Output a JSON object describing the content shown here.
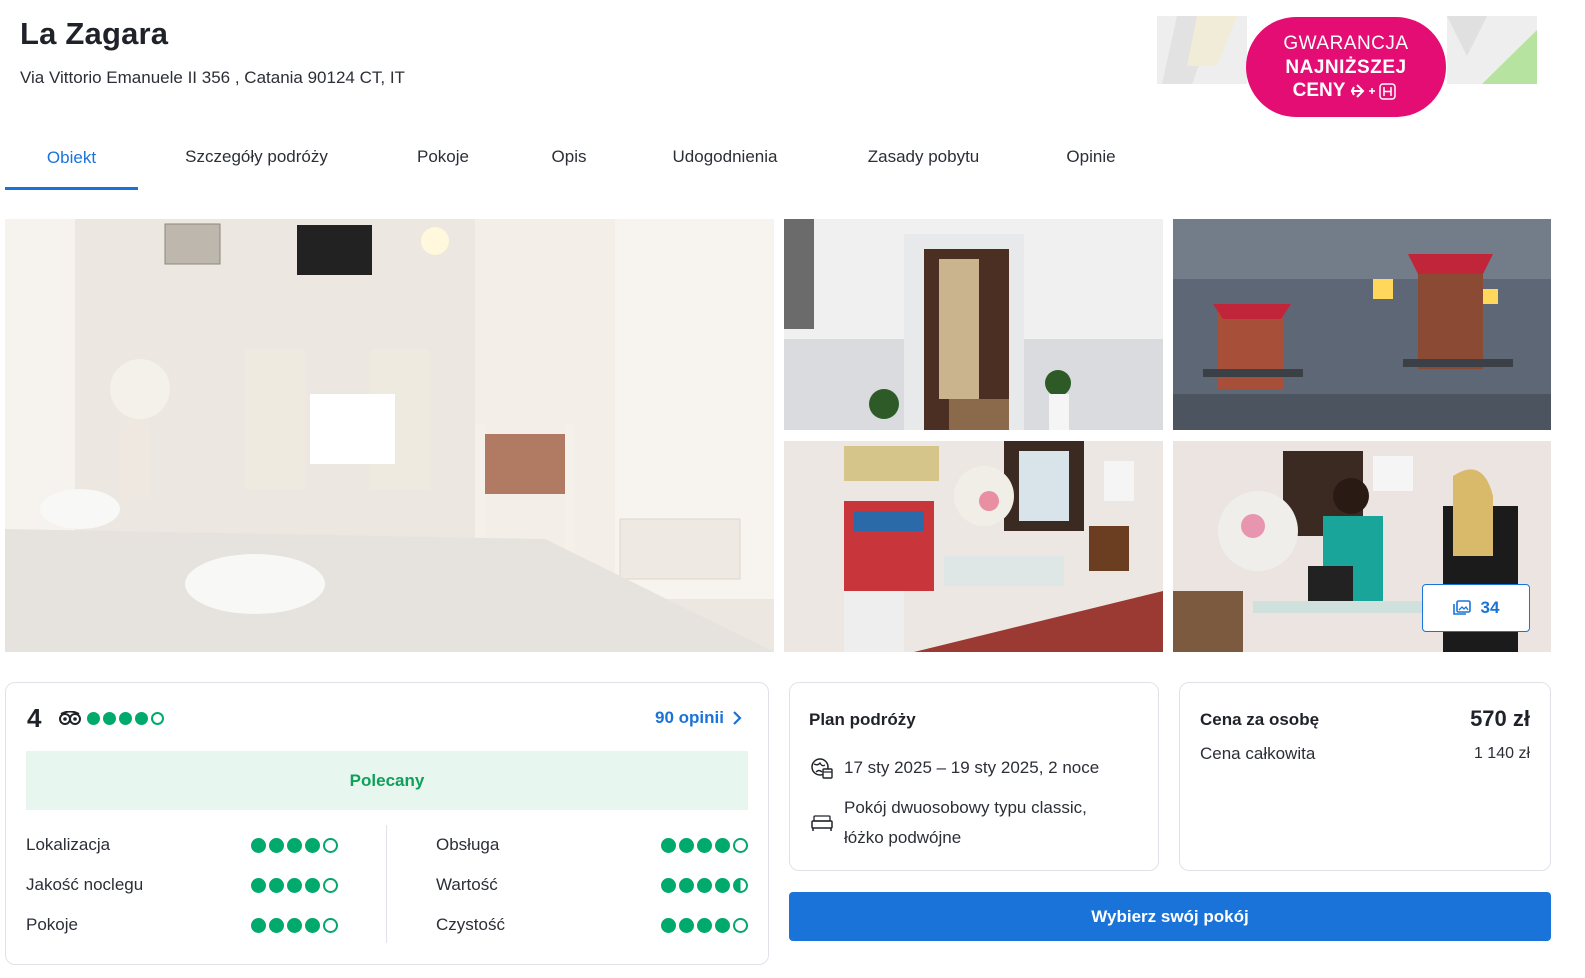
{
  "hotel": {
    "name": "La Zagara",
    "address": "Via Vittorio Emanuele II 356 , Catania 90124 CT, IT"
  },
  "badge": {
    "line1": "GWARANCJA",
    "line2": "NAJNIŻSZEJ",
    "line3": "CENY",
    "icon": "plane-plus-hotel-icon",
    "color": "#e40d74"
  },
  "tabs": [
    {
      "label": "Obiekt",
      "active": true
    },
    {
      "label": "Szczegóły podróży"
    },
    {
      "label": "Pokoje"
    },
    {
      "label": "Opis"
    },
    {
      "label": "Udogodnienia"
    },
    {
      "label": "Zasady pobytu"
    },
    {
      "label": "Opinie"
    }
  ],
  "gallery": {
    "photo_count": "34",
    "icon": "gallery-icon"
  },
  "reviews": {
    "score": "4",
    "rating": 4,
    "count_label": "90 opinii",
    "recommendation": "Polecany",
    "categories": [
      {
        "label": "Lokalizacja",
        "rating": 4
      },
      {
        "label": "Jakość noclegu",
        "rating": 4
      },
      {
        "label": "Pokoje",
        "rating": 4
      },
      {
        "label": "Obsługa",
        "rating": 4
      },
      {
        "label": "Wartość",
        "rating": 4.5
      },
      {
        "label": "Czystość",
        "rating": 4
      }
    ]
  },
  "plan": {
    "title": "Plan podróży",
    "dates": "17 sty 2025 – 19 sty 2025, 2 noce",
    "room_line1": "Pokój dwuosobowy typu classic,",
    "room_line2": "łóżko podwójne"
  },
  "price": {
    "per_person_label": "Cena za osobę",
    "per_person_value": "570 zł",
    "total_label": "Cena całkowita",
    "total_value": "1 140 zł"
  },
  "cta": {
    "label": "Wybierz swój pokój"
  },
  "colors": {
    "accent": "#1a73d9",
    "rating_green": "#00aa6c",
    "recommended_bg": "#e7f6ef",
    "recommended_text": "#10a05a"
  }
}
